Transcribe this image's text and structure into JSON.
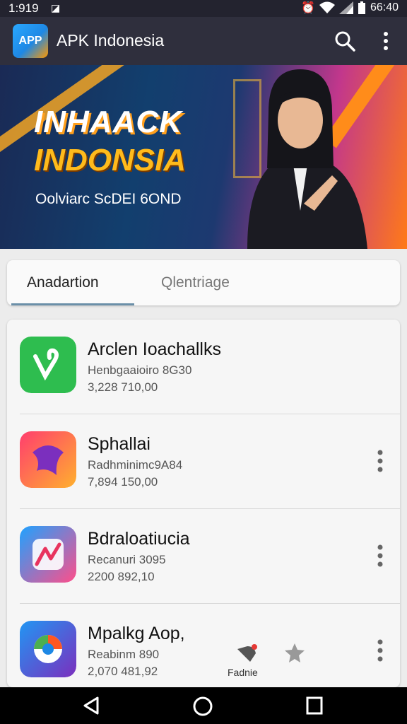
{
  "status_bar": {
    "time": "1:919",
    "clock": "66:40"
  },
  "app_bar": {
    "logo_text": "APP",
    "title": "APK Indonesia"
  },
  "banner": {
    "headline_1": "INHAACK",
    "headline_2": "INDONSIA",
    "subtitle": "Oolviarc ScDEI 6OND"
  },
  "tabs": [
    {
      "label": "Anadartion",
      "active": true
    },
    {
      "label": "Qlentriage",
      "active": false
    }
  ],
  "apps": [
    {
      "name": "Arclen Ioachallks",
      "line1": "Henbgaaioiro 8G30",
      "line2": "3,228 710,00",
      "icon_color": "#2ebd4f",
      "icon": "vine-logo-icon"
    },
    {
      "name": "Sphallai",
      "line1": "Radhminimc9A84",
      "line2": "7,894 150,00",
      "icon_color": "#ff6a3d",
      "icon": "bird-logo-icon"
    },
    {
      "name": "Bdraloatiucia",
      "line1": "Recanuri 3095",
      "line2": "2200 892,10",
      "icon_color": "#e94e77",
      "icon": "chart-logo-icon"
    },
    {
      "name": "Mpalkg Aop,",
      "line1": "Reabinm 890",
      "line2": "2,070 481,92",
      "icon_color": "#5b4ad6",
      "icon": "browser-logo-icon"
    }
  ],
  "floating": {
    "fav_label": "Fadnie"
  },
  "colors": {
    "app_bar": "#2f2f3d",
    "status_bar": "#23232f",
    "tab_indicator": "#6b8fa8"
  }
}
